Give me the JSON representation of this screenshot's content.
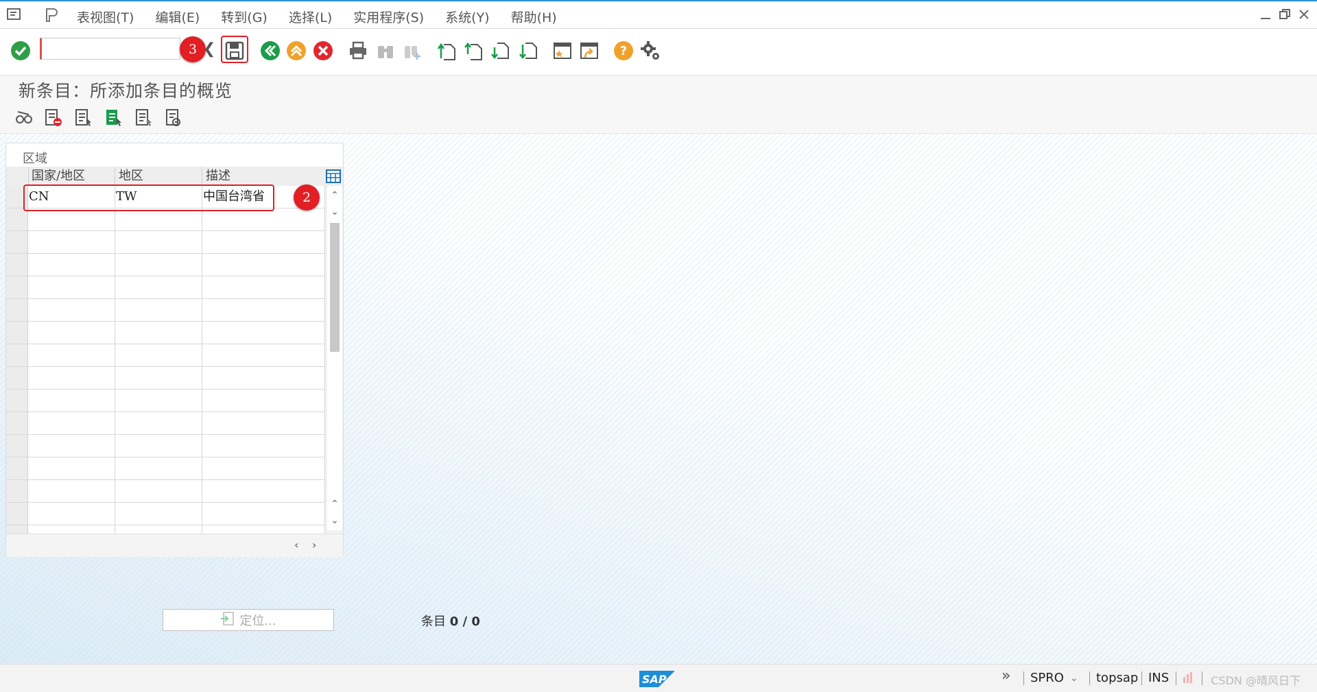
{
  "menubar": {
    "items": [
      {
        "label": "表视图(T)"
      },
      {
        "label": "编辑(E)"
      },
      {
        "label": "转到(G)"
      },
      {
        "label": "选择(L)"
      },
      {
        "label": "实用程序(S)"
      },
      {
        "label": "系统(Y)"
      },
      {
        "label": "帮助(H)"
      }
    ]
  },
  "toolbar": {
    "command_value": "",
    "icons": [
      "enter-icon",
      "save-icon",
      "back-icon",
      "exit-icon",
      "cancel-icon",
      "print-icon",
      "find-icon",
      "find-next-icon",
      "first-page-icon",
      "previous-page-icon",
      "next-page-icon",
      "last-page-icon",
      "create-session-icon",
      "shortcut-icon",
      "help-icon",
      "customize-layout-icon"
    ],
    "markers": {
      "save": "3",
      "row": "2"
    }
  },
  "page": {
    "title": "新条目：所添加条目的概览"
  },
  "app_toolbar": {
    "icons": [
      "display-change-icon",
      "delete-icon",
      "select-all-icon",
      "select-block-icon",
      "deselect-all-icon",
      "print-list-icon"
    ]
  },
  "panel": {
    "title": "区域",
    "columns": [
      "国家/地区",
      "地区",
      "描述"
    ],
    "rows": [
      {
        "country": "CN",
        "region": "TW",
        "desc": "中国台湾省"
      },
      {
        "country": "",
        "region": "",
        "desc": ""
      },
      {
        "country": "",
        "region": "",
        "desc": ""
      },
      {
        "country": "",
        "region": "",
        "desc": ""
      },
      {
        "country": "",
        "region": "",
        "desc": ""
      },
      {
        "country": "",
        "region": "",
        "desc": ""
      },
      {
        "country": "",
        "region": "",
        "desc": ""
      },
      {
        "country": "",
        "region": "",
        "desc": ""
      },
      {
        "country": "",
        "region": "",
        "desc": ""
      },
      {
        "country": "",
        "region": "",
        "desc": ""
      },
      {
        "country": "",
        "region": "",
        "desc": ""
      },
      {
        "country": "",
        "region": "",
        "desc": ""
      },
      {
        "country": "",
        "region": "",
        "desc": ""
      },
      {
        "country": "",
        "region": "",
        "desc": ""
      },
      {
        "country": "",
        "region": "",
        "desc": ""
      },
      {
        "country": "",
        "region": "",
        "desc": ""
      }
    ]
  },
  "footer": {
    "locate_label": "定位...",
    "entry_label": "条目",
    "entry_value": "0 / 0"
  },
  "statusbar": {
    "transaction": "SPRO",
    "server": "topsap",
    "mode": "INS",
    "watermark": "CSDN @晴风日下"
  },
  "colors": {
    "accent": "#2a8fd6",
    "marker": "#e11f25",
    "ok": "#2e9e47",
    "back": "#1b9c4b",
    "exit": "#f0a12a",
    "cancel": "#e2262e"
  }
}
